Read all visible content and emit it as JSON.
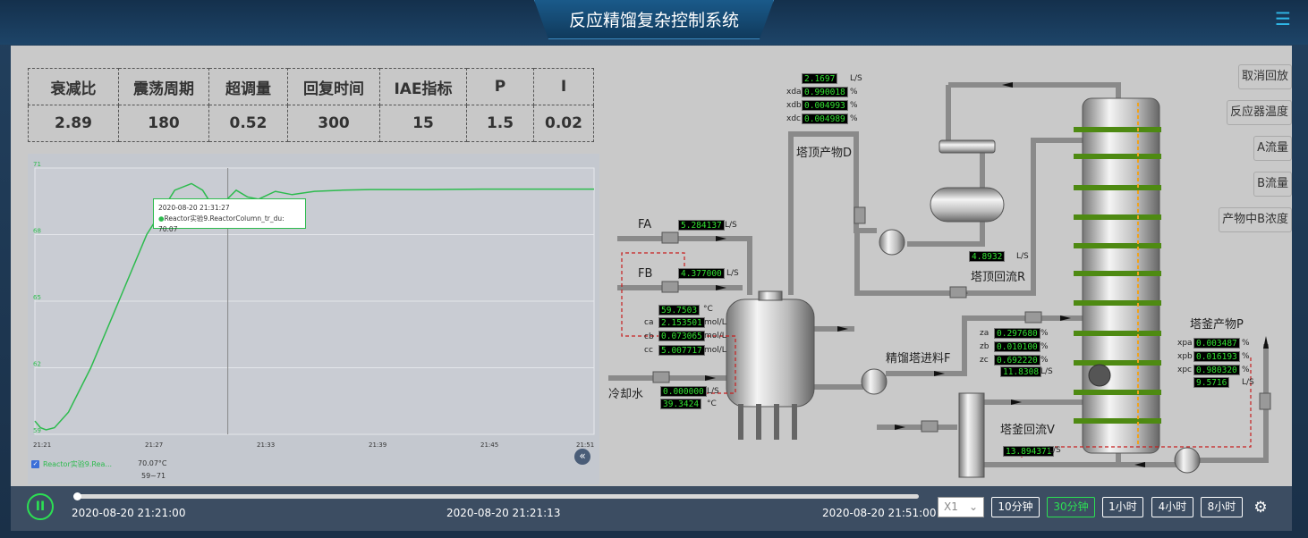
{
  "app": {
    "title": "反应精馏复杂控制系统"
  },
  "metrics": {
    "headers": [
      "衰减比",
      "震荡周期",
      "超调量",
      "回复时间",
      "IAE指标",
      "P",
      "I"
    ],
    "values": [
      "2.89",
      "180",
      "0.52",
      "300",
      "15",
      "1.5",
      "0.02"
    ]
  },
  "chart_data": {
    "type": "line",
    "x_ticks": [
      "21:21",
      "21:27",
      "21:33",
      "21:39",
      "21:45",
      "21:51"
    ],
    "y_ticks": [
      "59",
      "62",
      "65",
      "68",
      "71"
    ],
    "ylim": [
      59,
      71
    ],
    "series": [
      {
        "name": "Reactor实验9.ReactorColumn_tr_du",
        "color": "#2dbb4e",
        "x": [
          0,
          0.01,
          0.02,
          0.035,
          0.06,
          0.1,
          0.15,
          0.2,
          0.25,
          0.28,
          0.3,
          0.32,
          0.34,
          0.36,
          0.38,
          0.4,
          0.43,
          0.46,
          0.5,
          0.55,
          0.6,
          0.7,
          0.8,
          0.9,
          1.0
        ],
        "y": [
          59.6,
          59.3,
          59.2,
          59.3,
          60.0,
          62.0,
          65.0,
          68.0,
          70.0,
          70.3,
          70.0,
          69.2,
          69.5,
          70.0,
          69.7,
          69.6,
          69.95,
          69.8,
          69.95,
          70.0,
          70.03,
          70.03,
          70.05,
          70.05,
          70.05
        ]
      }
    ],
    "tooltip": {
      "time": "2020-08-20 21:31:27",
      "label": "Reactor实验9.ReactorColumn_tr_du: 70.07"
    },
    "cursor_x": 0.345,
    "legend": {
      "label": "Reactor实验9.Rea...",
      "value": "70.07°C",
      "range": "59~71"
    }
  },
  "process": {
    "labels": {
      "fa": "FA",
      "fb": "FB",
      "cooling": "冷却水",
      "top_product": "塔顶产物D",
      "reflux": "塔顶回流R",
      "feed": "精馏塔进料F",
      "bottom_product": "塔釜产物P",
      "reboil": "塔釜回流V"
    },
    "values": {
      "d_flow": "2.1697",
      "xda": "0.990018",
      "xdb": "0.004993",
      "xdc": "0.004989",
      "fa_flow": "5.284137",
      "fb_flow": "4.377000",
      "temp": "59.7503",
      "ca": "2.153501",
      "cb": "0.073065",
      "cc": "5.007717",
      "cool_flow": "0.000000",
      "cool_temp": "39.3424",
      "r_flow": "4.8932",
      "za": "0.297680",
      "zb": "0.010100",
      "zc": "0.692220",
      "f_flow": "11.8308",
      "xpa": "0.003487",
      "xpb": "0.016193",
      "xpc": "0.980320",
      "p_flow": "9.5716",
      "v_flow": "13.894371"
    },
    "tags": {
      "xda": "xda",
      "xdb": "xdb",
      "xdc": "xdc",
      "ca": "ca",
      "cb": "cb",
      "cc": "cc",
      "za": "za",
      "zb": "zb",
      "zc": "zc",
      "xpa": "xpa",
      "xpb": "xpb",
      "xpc": "xpc"
    },
    "units": {
      "flow": "L/S",
      "frac": "%",
      "temp": "°C",
      "conc": "mol/L"
    }
  },
  "side_buttons": [
    "取消回放",
    "反应器温度",
    "A流量",
    "B流量",
    "产物中B浓度"
  ],
  "playback": {
    "start": "2020-08-20 21:21:00",
    "current": "2020-08-20 21:21:13",
    "end": "2020-08-20 21:51:00",
    "speed": "X1",
    "ranges": [
      "10分钟",
      "30分钟",
      "1小时",
      "4小时",
      "8小时"
    ],
    "active_range": "30分钟",
    "progress": 0.007
  }
}
